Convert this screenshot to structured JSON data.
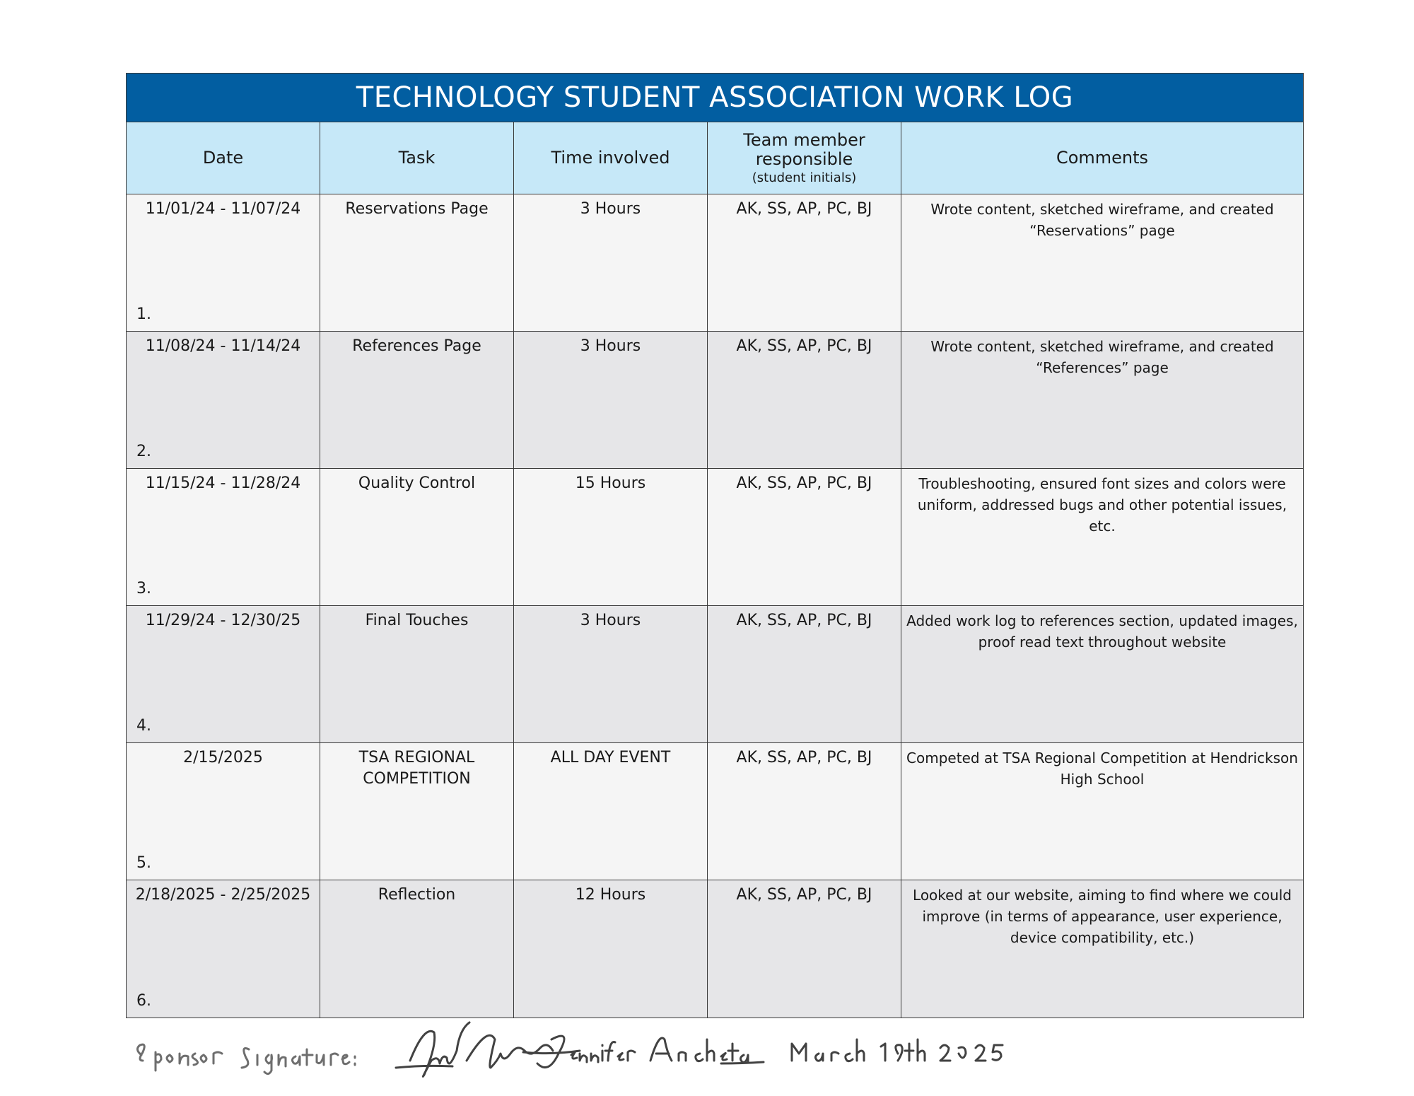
{
  "title": "TECHNOLOGY STUDENT ASSOCIATION WORK LOG",
  "headers": {
    "date": "Date",
    "task": "Task",
    "time": "Time involved",
    "member": "Team member responsible",
    "member_sub": "(student initials)",
    "comments": "Comments"
  },
  "rows": [
    {
      "num": "1.",
      "date": "11/01/24 - 11/07/24",
      "task": "Reservations Page",
      "time": "3 Hours",
      "members": "AK, SS, AP, PC, BJ",
      "comments": "Wrote content, sketched wireframe, and created “Reservations” page"
    },
    {
      "num": "2.",
      "date": "11/08/24 - 11/14/24",
      "task": "References Page",
      "time": "3 Hours",
      "members": "AK, SS, AP, PC, BJ",
      "comments": "Wrote content, sketched wireframe, and created “References” page"
    },
    {
      "num": "3.",
      "date": "11/15/24 - 11/28/24",
      "task": "Quality Control",
      "time": "15 Hours",
      "members": "AK, SS, AP, PC, BJ",
      "comments": "Troubleshooting, ensured font sizes and colors were uniform, addressed bugs and other potential issues, etc."
    },
    {
      "num": "4.",
      "date": "11/29/24 - 12/30/25",
      "task": "Final Touches",
      "time": "3 Hours",
      "members": "AK, SS, AP, PC, BJ",
      "comments": "Added work log to references section, updated images, proof read text throughout website"
    },
    {
      "num": "5.",
      "date": "2/15/2025",
      "task": "TSA REGIONAL COMPETITION",
      "time": "ALL DAY EVENT",
      "members": "AK, SS, AP, PC, BJ",
      "comments": "Competed at TSA Regional Competition at Hendrickson High School"
    },
    {
      "num": "6.",
      "date": "2/18/2025 - 2/25/2025",
      "task": "Reflection",
      "time": "12 Hours",
      "members": "AK, SS, AP, PC, BJ",
      "comments": "Looked at our website, aiming to find where we could improve (in terms of appearance, user experience, device compatibility, etc.)"
    }
  ],
  "signature": {
    "label": "Sponsor Signature:",
    "name": "Jennifer Ancheta",
    "date": "March 19th 2025"
  },
  "colors": {
    "title_bg": "#025ea1",
    "header_bg": "#c6e8f8",
    "row_light": "#f5f5f5",
    "row_dark": "#e6e6e8"
  }
}
